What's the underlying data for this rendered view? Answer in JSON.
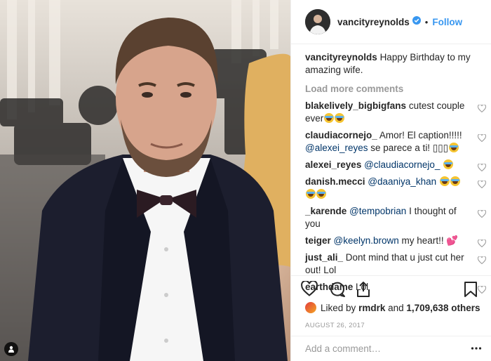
{
  "colors": {
    "accent": "#3897f0",
    "text": "#262626",
    "muted": "#999999",
    "border": "#efefef"
  },
  "photo": {
    "tag_icon": "person-icon"
  },
  "header": {
    "username": "vancityreynolds",
    "verified_icon": "verified-badge-icon",
    "dot": "•",
    "follow": "Follow"
  },
  "caption": {
    "username": "vancityreynolds",
    "text": "Happy Birthday to my amazing wife."
  },
  "load_more": "Load more comments",
  "comments": [
    {
      "username": "blakelively_bigbigfans",
      "parts": [
        "cutest couple ever"
      ],
      "emoji": 2
    },
    {
      "username": "claudiacornejo_",
      "parts": [
        "Amor! El caption!!!!!"
      ],
      "mention": "@alexei_reyes",
      "after": "se parece a ti! ▯▯▯",
      "emoji": 1
    },
    {
      "username": "alexei_reyes",
      "mention": "@claudiacornejo_",
      "emoji": 1
    },
    {
      "username": "danish.mecci",
      "mention": "@daaniya_khan",
      "emoji": 4
    },
    {
      "username": "_karende",
      "mention": "@tempobrian",
      "after": "I thought of you"
    },
    {
      "username": "teiger",
      "mention": "@keelyn.brown",
      "after": "my heart!!",
      "heart": "💕"
    },
    {
      "username": "just_ali_",
      "parts": [
        "Dont mind that u just cut her out! Lol"
      ]
    },
    {
      "username": "earthdame",
      "parts": [
        "Lol"
      ]
    }
  ],
  "actions": {
    "like": "heart-icon",
    "comment": "comment-icon",
    "share": "share-icon",
    "save": "bookmark-icon"
  },
  "likes": {
    "prefix": "Liked by",
    "user": "rmdrk",
    "and": "and",
    "count": "1,709,638 others"
  },
  "date": "AUGUST 26, 2017",
  "add_comment": {
    "placeholder": "Add a comment…",
    "more_icon": "more-options-icon"
  }
}
